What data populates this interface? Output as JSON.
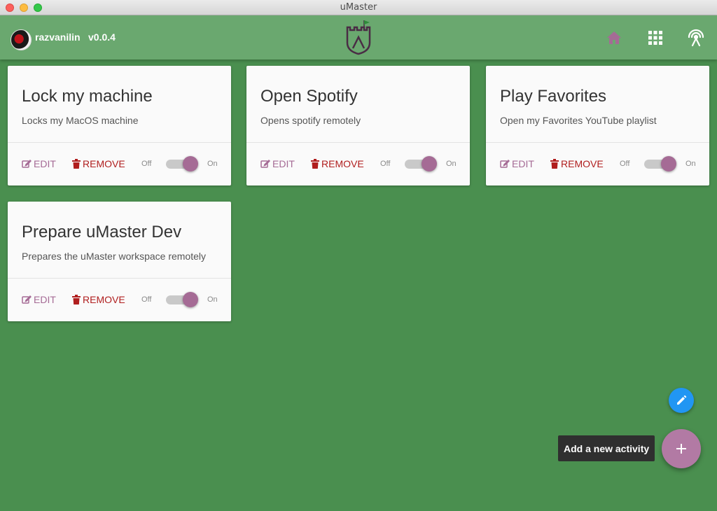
{
  "window": {
    "title": "uMaster"
  },
  "header": {
    "username": "razvanilin",
    "version": "v0.0.4"
  },
  "nav": {
    "home_icon": "home-icon",
    "apps_icon": "apps-grid-icon",
    "remote_icon": "remote-antenna-icon",
    "active_color": "#a56b95"
  },
  "colors": {
    "background": "#4a8f4f",
    "appbar": "#6aa86f",
    "accent": "#a56b95",
    "danger": "#b01e1e",
    "fab_blue": "#2196f3",
    "fab_purple": "#b27aa4"
  },
  "cards": [
    {
      "title": "Lock my machine",
      "description": "Locks my MacOS machine",
      "edit_label": "EDIT",
      "remove_label": "REMOVE",
      "off_label": "Off",
      "on_label": "On",
      "enabled": true
    },
    {
      "title": "Open Spotify",
      "description": "Opens spotify remotely",
      "edit_label": "EDIT",
      "remove_label": "REMOVE",
      "off_label": "Off",
      "on_label": "On",
      "enabled": true
    },
    {
      "title": "Play Favorites",
      "description": "Open my Favorites YouTube playlist",
      "edit_label": "EDIT",
      "remove_label": "REMOVE",
      "off_label": "Off",
      "on_label": "On",
      "enabled": true
    },
    {
      "title": "Prepare uMaster Dev",
      "description": "Prepares the uMaster workspace remotely",
      "edit_label": "EDIT",
      "remove_label": "REMOVE",
      "off_label": "Off",
      "on_label": "On",
      "enabled": true
    }
  ],
  "fab": {
    "tooltip": "Add a new activity",
    "edit_icon": "pencil-icon",
    "add_icon": "plus-icon"
  }
}
